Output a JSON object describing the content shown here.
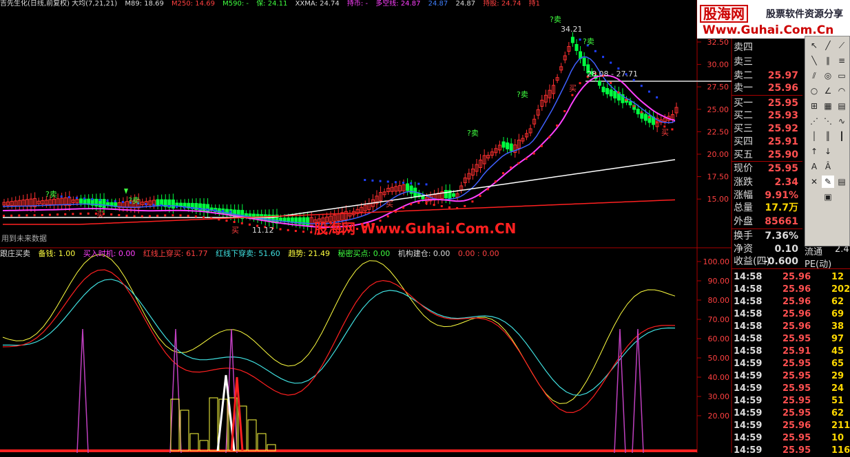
{
  "chart_header": {
    "title": "吉先生化(日线,前复权) 大均(7,21,21)",
    "m89": "M89: 18.69",
    "m250": "M250: 14.69",
    "m590": "M590: -",
    "bao": "保: 24.11",
    "xxma": "XXMA: 24.74",
    "chibi": "持币: -",
    "duokong": "多空线: 24.87",
    "val1": "24.87",
    "val2": "24.87",
    "chigu": "持股: 24.74",
    "chiyi": "持1"
  },
  "price_axis": [
    "32.50",
    "30.00",
    "27.50",
    "25.00",
    "22.50",
    "20.00",
    "17.50",
    "15.00"
  ],
  "indicator_axis": [
    "100.00",
    "90.00",
    "80.00",
    "70.00",
    "60.00",
    "50.00",
    "40.00",
    "30.00",
    "20.00"
  ],
  "indicator_header": {
    "name": "跟庄买卖",
    "beiqian": "备钱: 1.00",
    "maishi": "买入时机: 0.00",
    "hongxian_shang": "红线上穿买: 61.77",
    "hongxian_xia": "红线下穿卖: 51.60",
    "qushi": "趋势: 21.49",
    "mimi": "秘密买点: 0.00",
    "jigou": "机构建仓: 0.00",
    "extra": "0.00 : 0.00"
  },
  "chart_labels": {
    "sell1": "?卖",
    "sell2": "?卖",
    "sell3": "?卖",
    "sell4": "?卖",
    "sell5": "?卖",
    "sell6": "?卖",
    "buy1": "买",
    "buy2": "买",
    "buy3": "买",
    "buy4": "买",
    "buy5": "买",
    "high": "34.21",
    "low": "11.12",
    "range": "28.08 - 27.71",
    "future": "用到未来数据"
  },
  "watermark": "股海网 Www.Guhai.Com.CN",
  "logo": {
    "brand": "股海网",
    "tagline": "股票软件资源分享",
    "url": "Www.Guhai.Com.Cn"
  },
  "order_book": [
    {
      "label": "卖四",
      "value": ""
    },
    {
      "label": "卖三",
      "value": ""
    },
    {
      "label": "卖二",
      "value": "25.97"
    },
    {
      "label": "卖一",
      "value": "25.96"
    },
    {
      "label": "买一",
      "value": "25.95"
    },
    {
      "label": "买二",
      "value": "25.93"
    },
    {
      "label": "买三",
      "value": "25.92"
    },
    {
      "label": "买四",
      "value": "25.91"
    },
    {
      "label": "买五",
      "value": "25.90"
    }
  ],
  "stats": [
    {
      "label": "现价",
      "value": "25.95"
    },
    {
      "label": "涨跌",
      "value": "2.34"
    },
    {
      "label": "涨幅",
      "value": "9.91%"
    },
    {
      "label": "总量",
      "value": "17.7万"
    },
    {
      "label": "外盘",
      "value": "85661"
    },
    {
      "label": "换手",
      "value": "7.36%"
    },
    {
      "label": "净资",
      "value": "0.10"
    },
    {
      "label": "收益(四)",
      "value": "-0.600"
    }
  ],
  "stat_extra": {
    "liutong": "流通",
    "liutong_val": "2.4",
    "pe": "PE(动)"
  },
  "ticks": [
    {
      "t": "14:58",
      "p": "25.96",
      "q": "12"
    },
    {
      "t": "14:58",
      "p": "25.96",
      "q": "202"
    },
    {
      "t": "14:58",
      "p": "25.96",
      "q": "62"
    },
    {
      "t": "14:58",
      "p": "25.96",
      "q": "69"
    },
    {
      "t": "14:58",
      "p": "25.96",
      "q": "38"
    },
    {
      "t": "14:58",
      "p": "25.95",
      "q": "97"
    },
    {
      "t": "14:58",
      "p": "25.91",
      "q": "45"
    },
    {
      "t": "14:59",
      "p": "25.95",
      "q": "65"
    },
    {
      "t": "14:59",
      "p": "25.95",
      "q": "29"
    },
    {
      "t": "14:59",
      "p": "25.95",
      "q": "24"
    },
    {
      "t": "14:59",
      "p": "25.95",
      "q": "51"
    },
    {
      "t": "14:59",
      "p": "25.95",
      "q": "62"
    },
    {
      "t": "14:59",
      "p": "25.96",
      "q": "211"
    },
    {
      "t": "14:59",
      "p": "25.95",
      "q": "10"
    },
    {
      "t": "14:59",
      "p": "25.95",
      "q": "116"
    }
  ],
  "colors": {
    "up": "#ff3030",
    "down": "#00ff40",
    "ma_blue": "#4060ff",
    "ma_white": "#ffffff",
    "ma_red": "#ff2020",
    "dots_red": "#ff2020",
    "dots_blue": "#2040ff",
    "purple": "#ff40ff",
    "yellow": "#ffff40",
    "cyan": "#40e0e0",
    "magenta": "#c040c0"
  }
}
